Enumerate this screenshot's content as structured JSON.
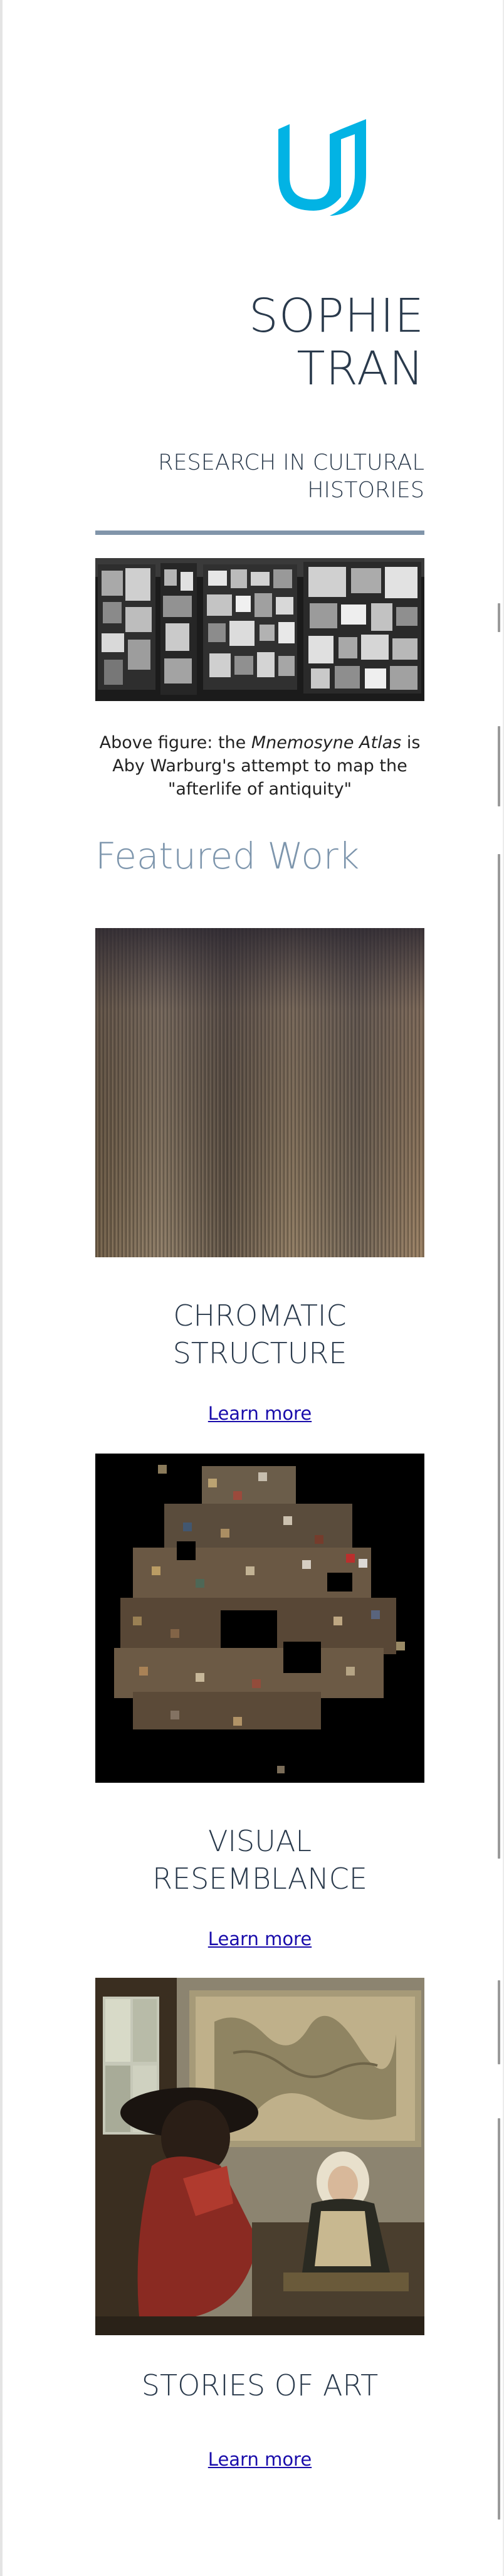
{
  "header": {
    "name": "SOPHIE TRAN",
    "name_line1": "SOPHIE",
    "name_line2": "TRAN",
    "subtitle_line1": "RESEARCH IN CULTURAL",
    "subtitle_line2": "HISTORIES",
    "logo_icon": "udacity-u-logo-icon"
  },
  "intro_figure": {
    "caption_prefix": "Above figure: the ",
    "caption_em": "Mnemosyne Atlas",
    "caption_suffix": " is Aby Warburg's attempt to map the \"afterlife of antiquity\""
  },
  "featured": {
    "title": "Featured Work",
    "items": [
      {
        "title_line1": "CHROMATIC",
        "title_line2": "STRUCTURE",
        "link": "Learn more"
      },
      {
        "title_line1": "VISUAL",
        "title_line2": "RESEMBLANCE",
        "link": "Learn more"
      },
      {
        "title_line1": "STORIES OF ART",
        "title_line2": "",
        "link": "Learn more"
      }
    ]
  },
  "colors": {
    "accent": "#02b3e4",
    "rule": "#8195aa",
    "heading": "#2a3a4c",
    "section_title": "#7e96ad",
    "link": "#1a0dab"
  }
}
